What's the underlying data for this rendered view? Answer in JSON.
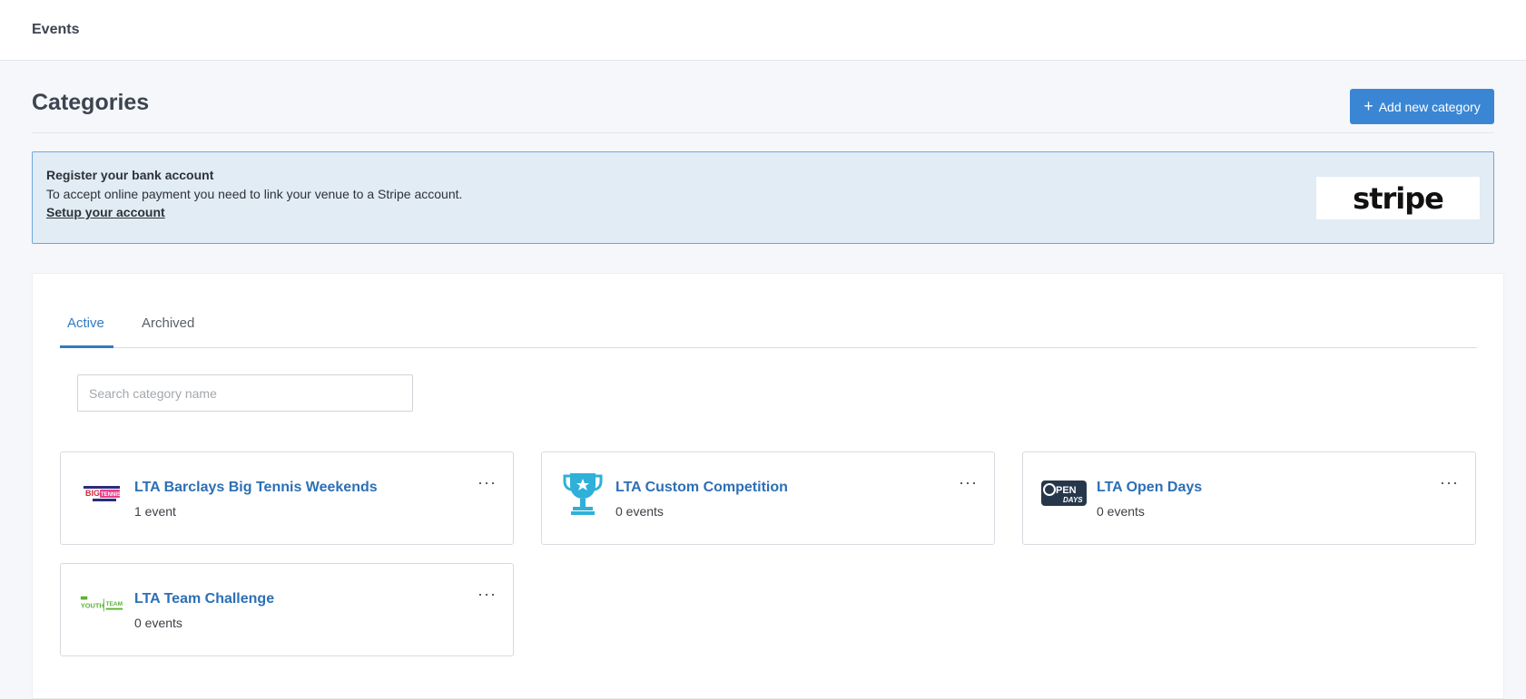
{
  "topbar": {
    "title": "Events"
  },
  "header": {
    "title": "Categories",
    "add_button_label": "Add new category"
  },
  "banner": {
    "title": "Register your bank account",
    "text": "To accept online payment you need to link your venue to a Stripe account.",
    "link": "Setup your account",
    "stripe_logo": "stripe"
  },
  "tabs": [
    {
      "label": "Active"
    },
    {
      "label": "Archived"
    }
  ],
  "search": {
    "placeholder": "Search category name",
    "value": ""
  },
  "categories": [
    {
      "name": "LTA Barclays Big Tennis Weekends",
      "count": "1 event",
      "icon": "big-tennis-weekends-logo"
    },
    {
      "name": "LTA Custom Competition",
      "count": "0 events",
      "icon": "trophy-icon"
    },
    {
      "name": "LTA Open Days",
      "count": "0 events",
      "icon": "open-days-logo"
    },
    {
      "name": "LTA Team Challenge",
      "count": "0 events",
      "icon": "youth-team-challenge-logo"
    }
  ],
  "menu_glyph": "···",
  "colors": {
    "accent": "#3a86d4",
    "link": "#2c6fb5",
    "banner_bg": "#e1ecf5",
    "trophy": "#2fb0d8"
  }
}
